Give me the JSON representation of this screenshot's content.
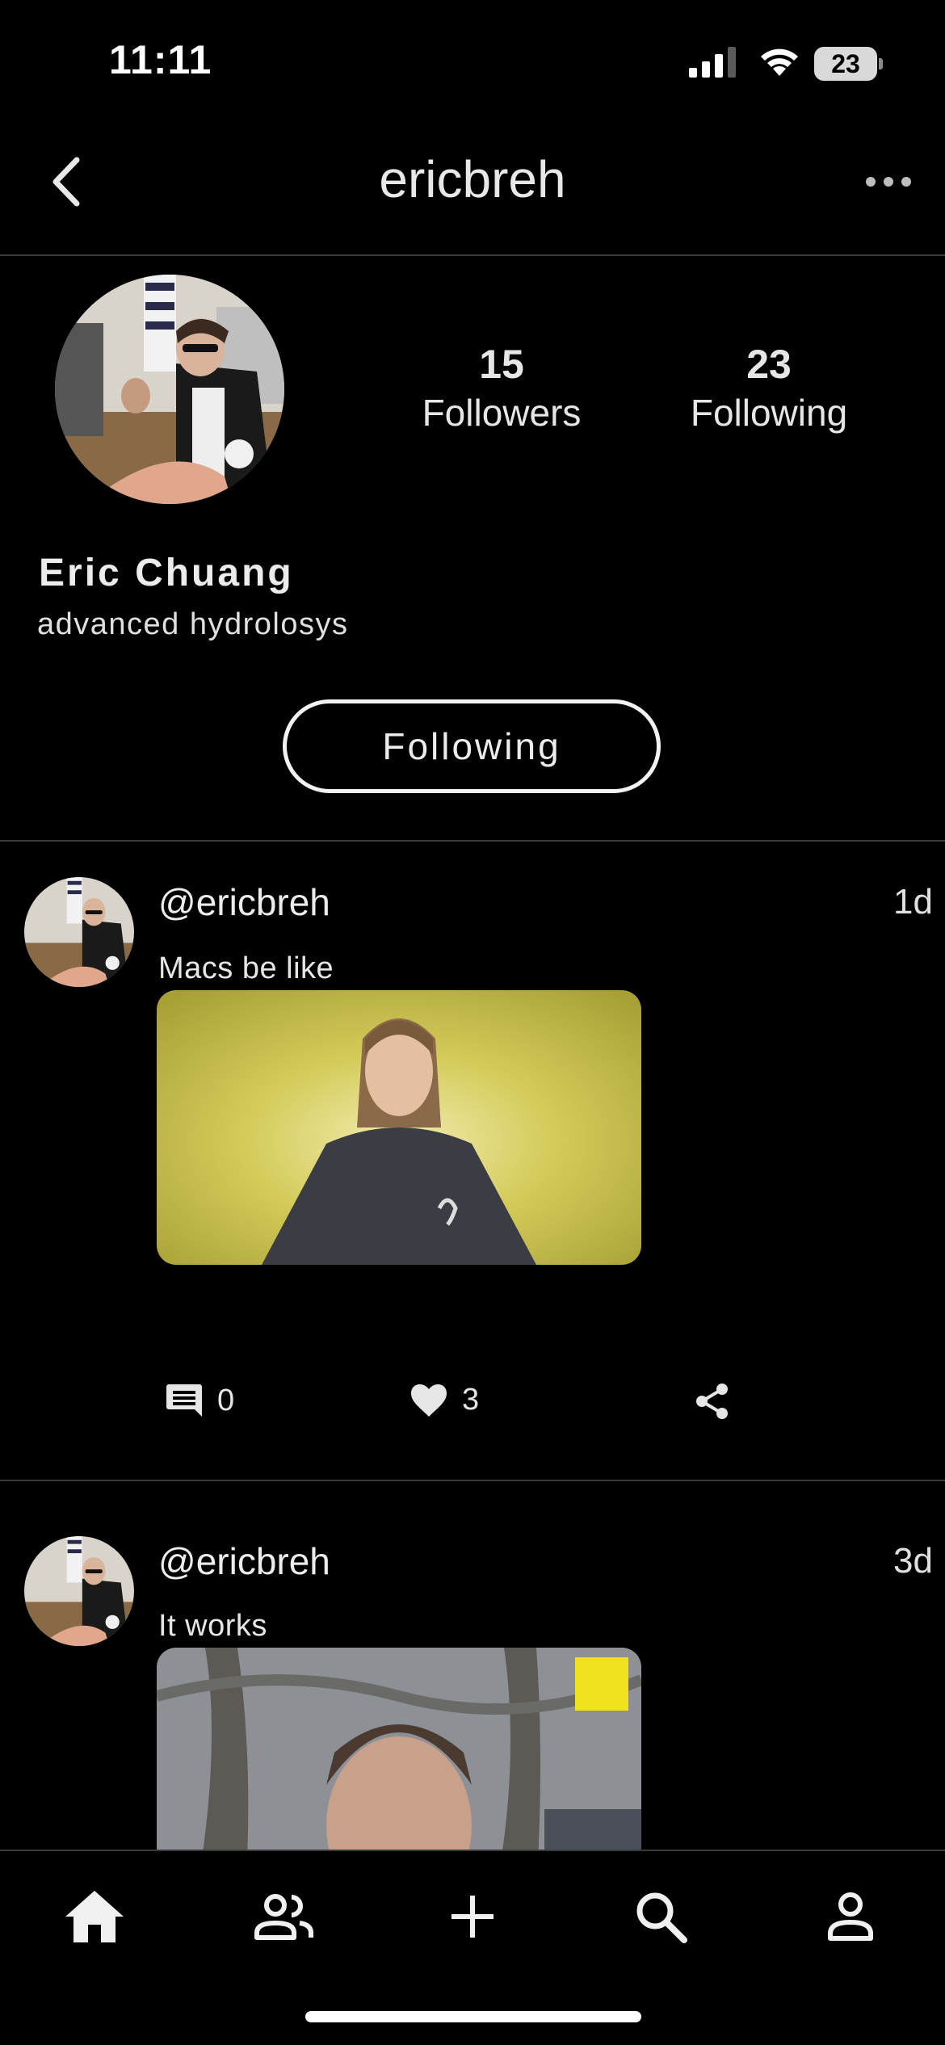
{
  "status_bar": {
    "time": "11:11",
    "battery": "23"
  },
  "header": {
    "title": "ericbreh"
  },
  "profile": {
    "followers_count": "15",
    "followers_label": "Followers",
    "following_count": "23",
    "following_label": "Following",
    "display_name": "Eric Chuang",
    "bio": "advanced hydrolosys",
    "follow_button_label": "Following"
  },
  "posts": [
    {
      "username": "@ericbreh",
      "time": "1d",
      "text": "Macs be like",
      "comments": "0",
      "likes": "3"
    },
    {
      "username": "@ericbreh",
      "time": "3d",
      "text": "It works"
    }
  ],
  "icons": {
    "back": "chevron-left-icon",
    "more": "more-horizontal-icon",
    "comment": "comment-icon",
    "like": "heart-icon",
    "share": "share-icon",
    "nav": [
      "home-icon",
      "people-icon",
      "plus-icon",
      "search-icon",
      "profile-icon"
    ]
  },
  "colors": {
    "background": "#000000",
    "text": "#ececec",
    "divider": "#3a3a3a",
    "gif1_bg": "#c9c04a"
  }
}
